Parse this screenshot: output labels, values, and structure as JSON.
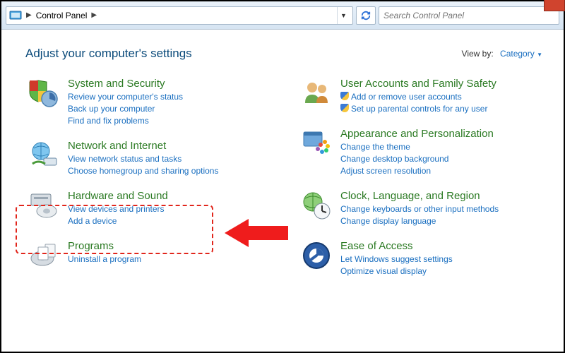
{
  "addressbar": {
    "location": "Control Panel"
  },
  "search": {
    "placeholder": "Search Control Panel"
  },
  "header": {
    "title": "Adjust your computer's settings",
    "viewby_label": "View by:",
    "viewby_value": "Category"
  },
  "left": [
    {
      "title": "System and Security",
      "links": [
        "Review your computer's status",
        "Back up your computer",
        "Find and fix problems"
      ]
    },
    {
      "title": "Network and Internet",
      "links": [
        "View network status and tasks",
        "Choose homegroup and sharing options"
      ]
    },
    {
      "title": "Hardware and Sound",
      "links": [
        "View devices and printers",
        "Add a device"
      ]
    },
    {
      "title": "Programs",
      "links": [
        "Uninstall a program"
      ]
    }
  ],
  "right": [
    {
      "title": "User Accounts and Family Safety",
      "links": [
        "Add or remove user accounts",
        "Set up parental controls for any user"
      ],
      "shielded": true
    },
    {
      "title": "Appearance and Personalization",
      "links": [
        "Change the theme",
        "Change desktop background",
        "Adjust screen resolution"
      ]
    },
    {
      "title": "Clock, Language, and Region",
      "links": [
        "Change keyboards or other input methods",
        "Change display language"
      ]
    },
    {
      "title": "Ease of Access",
      "links": [
        "Let Windows suggest settings",
        "Optimize visual display"
      ]
    }
  ]
}
